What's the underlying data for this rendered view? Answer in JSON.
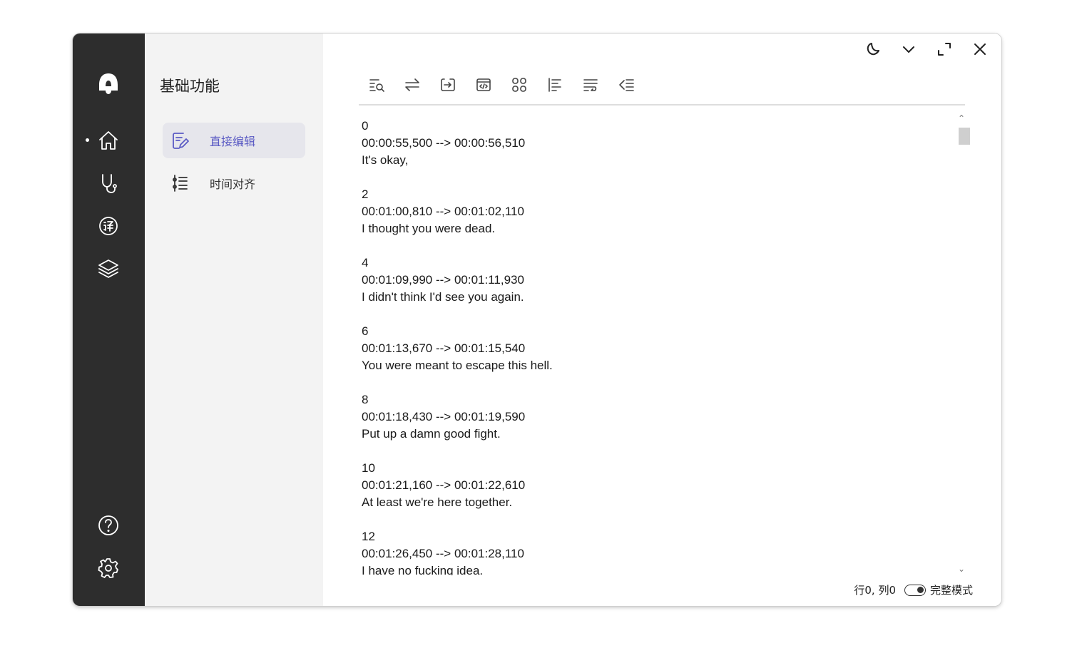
{
  "sidebar": {
    "title": "基础功能",
    "items": [
      {
        "label": "直接编辑",
        "icon": "edit-doc-icon",
        "active": true
      },
      {
        "label": "时间对齐",
        "icon": "timeline-align-icon",
        "active": false
      }
    ]
  },
  "rail": {
    "icons": [
      "app-logo-icon",
      "home-icon",
      "stethoscope-icon",
      "translate-icon",
      "layers-icon",
      "help-icon",
      "settings-icon"
    ]
  },
  "window_controls": [
    "theme-moon-icon",
    "collapse-chevron-icon",
    "maximize-icon",
    "close-icon"
  ],
  "toolbar": {
    "icons": [
      "find-icon",
      "swap-icon",
      "export-icon",
      "code-icon",
      "grid-icon",
      "align-left-icon",
      "wrap-icon",
      "outdent-icon"
    ]
  },
  "editor": {
    "lines": [
      "0",
      "00:00:55,500 --> 00:00:56,510",
      "It's okay,",
      "",
      "2",
      "00:01:00,810 --> 00:01:02,110",
      "I thought you were dead.",
      "",
      "4",
      "00:01:09,990 --> 00:01:11,930",
      "I didn't think I'd see you again.",
      "",
      "6",
      "00:01:13,670 --> 00:01:15,540",
      "You were meant to escape this hell.",
      "",
      "8",
      "00:01:18,430 --> 00:01:19,590",
      "Put up a damn good fight.",
      "",
      "10",
      "00:01:21,160 --> 00:01:22,610",
      "At least we're here together.",
      "",
      "12",
      "00:01:26,450 --> 00:01:28,110",
      "I have no fucking idea."
    ]
  },
  "status": {
    "position": "行0, 列0",
    "mode_label": "完整模式",
    "mode_on": true
  }
}
